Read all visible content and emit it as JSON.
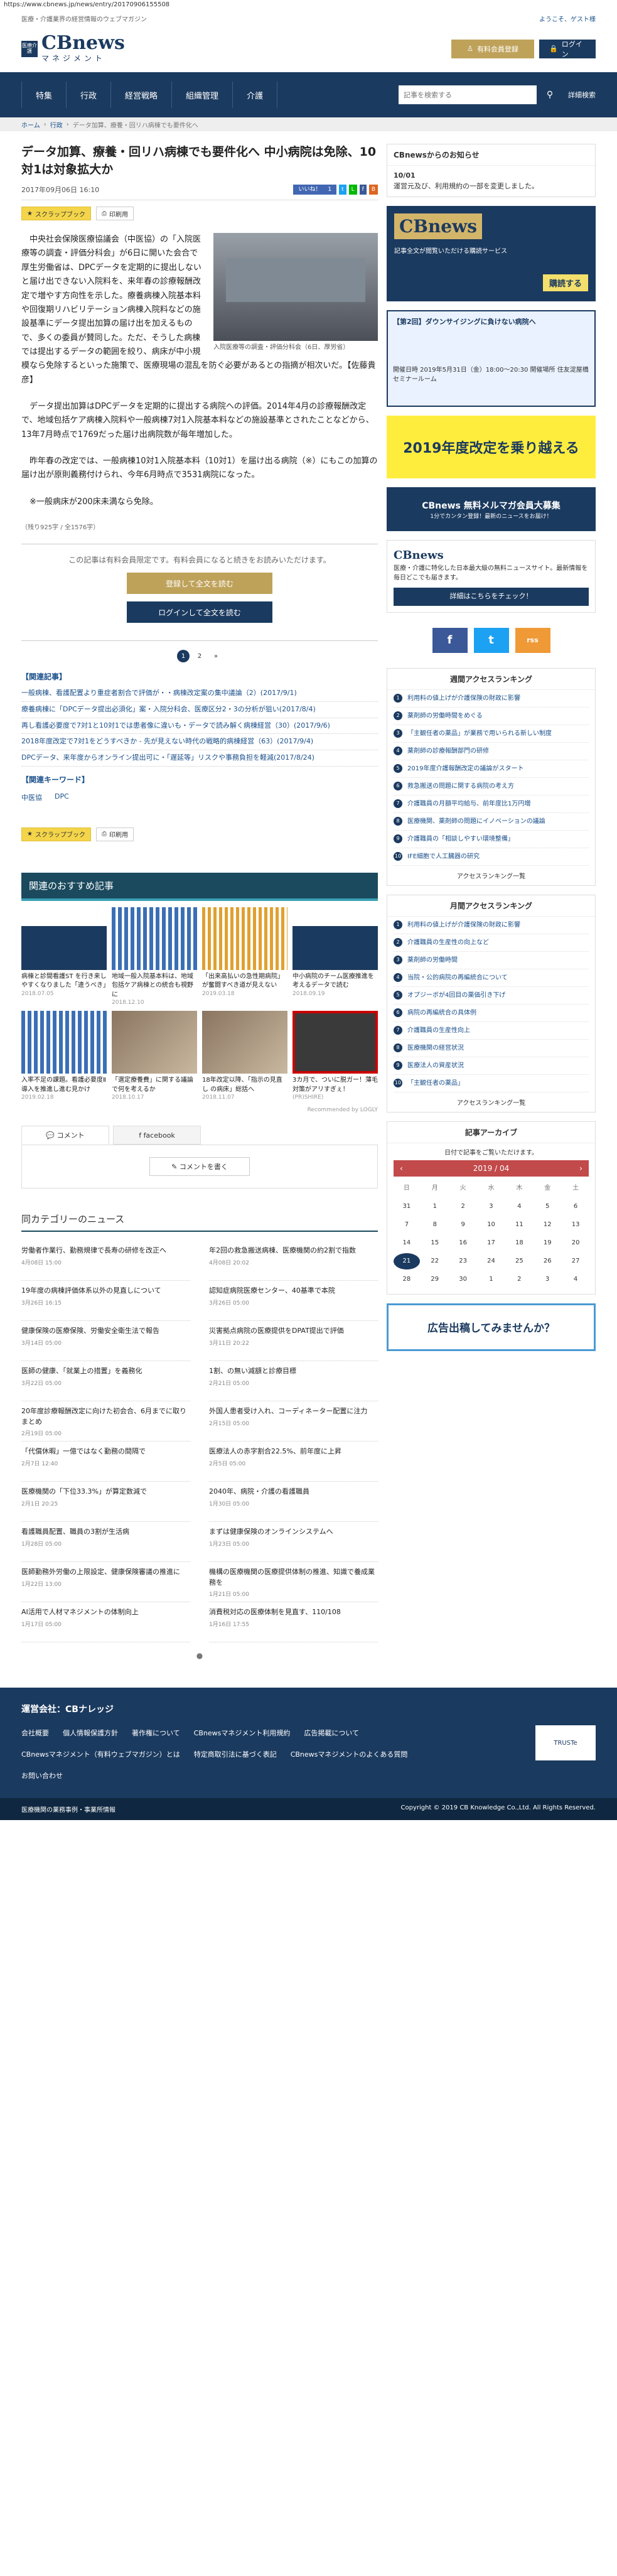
{
  "url": "https://www.cbnews.jp/news/entry/20170906155508",
  "top": {
    "tagline": "医療・介護業界の経営情報のウェブマガジン",
    "welcome": "ようこそ、ゲスト様"
  },
  "header": {
    "badge": "医療介護",
    "logo": "CBnews",
    "logo_sub": "マネジメント",
    "btn_register": "有料会員登録",
    "btn_login": "ログイン"
  },
  "nav": {
    "items": [
      "特集",
      "行政",
      "経営戦略",
      "組織管理",
      "介護"
    ],
    "search_placeholder": "記事を検索する",
    "adv_search": "詳細検索"
  },
  "crumb": [
    "ホーム",
    "行政",
    "データ加算、療養・回リハ病棟でも要件化へ"
  ],
  "article": {
    "title": "データ加算、療養・回リハ病棟でも要件化へ 中小病院は免除、10対1は対象拡大か",
    "date": "2017年09月06日 16:10",
    "like": "いいね！",
    "like_count": "1",
    "scrap": "スクラップブック",
    "print": "印刷用",
    "paragraphs": [
      "中央社会保険医療協議会（中医協）の「入院医療等の調査・評価分科会」が6日に開いた会合で厚生労働省は、DPCデータを定期的に提出しないと届け出できない入院料を、来年春の診療報酬改定で増やす方向性を示した。療養病棟入院基本料や回復期リハビリテーション病棟入院料などの施設基準にデータ提出加算の届け出を加えるもので、多くの委員が賛同した。ただ、そうした病棟では提出するデータの範囲を絞り、病床が中小規模なら免除するといった施策で、医療現場の混乱を防ぐ必要があるとの指摘が相次いだ。【佐藤貴彦】",
      "データ提出加算はDPCデータを定期的に提出する病院への評価。2014年4月の診療報酬改定で、地域包括ケア病棟入院料や一般病棟7対1入院基本料などの施設基準とされたことなどから、13年7月時点で1769だった届け出病院数が毎年増加した。",
      "昨年春の改定では、一般病棟10対1入院基本料（10対1）を届け出る病院（※）にもこの加算の届け出が原則義務付けられ、今年6月時点で3531病院になった。",
      "※一般病床が200床未満なら免除。"
    ],
    "photo_caption": "入院医療等の調査・評価分科会（6日、厚労省）",
    "char_count": "（残り925字 / 全1576字）",
    "paywall_msg": "この記事は有料会員限定です。有料会員になると続きをお読みいただけます。",
    "paywall_register": "登録して全文を読む",
    "paywall_login": "ログインして全文を読む",
    "pages": [
      "1",
      "2",
      "»"
    ],
    "related_title": "【関連記事】",
    "related": [
      "一般病棟、看護配置より重症者割合で評価が・・病棟改定案の集中議論（2）(2017/9/1)",
      "療養病棟に「DPCデータ提出必須化」案・入院分科会、医療区分2・3の分析が狙い(2017/8/4)",
      "再し看護必要度で7対1と10対1では患者像に違いも・データで読み解く病棟経営（30）(2017/9/6)",
      "2018年度改定で7対1をどうすべきか - 先が見えない時代の戦略的病棟経営（63）(2017/9/4)",
      "DPCデータ、来年度からオンライン提出可に・「遅延等」リスクや事務負担を軽減(2017/8/24)"
    ],
    "keyword_title": "【関連キーワード】",
    "keywords": [
      "中医協",
      "DPC"
    ]
  },
  "reco": {
    "title": "関連のおすすめ記事",
    "items": [
      {
        "t": "病棟と診間看護ST を行き来しやすくなりました「違うべき」",
        "d": "2018.07.05"
      },
      {
        "t": "地域一般入院基本料は、地域包括ケア病棟との統合も視野に",
        "d": "2018.12.10"
      },
      {
        "t": "「出来高払いの急性期病院」が奮闘すべき道が見えない",
        "d": "2019.03.18"
      },
      {
        "t": "中小病院のチーム医療推進を考えるデータで読む",
        "d": "2018.09.19"
      },
      {
        "t": "入率不足の課題。看護必要度Ⅱ導入を推進し進む見かけ",
        "d": "2019.02.18"
      },
      {
        "t": "「選定療養費」に関する議論で何を考えるか",
        "d": "2018.10.17"
      },
      {
        "t": "18年改定以降、「指示の見直し の病床」総括へ",
        "d": "2018.11.07"
      },
      {
        "t": "3カ月で、ついに脱ガー！薄毛対策がアリすぎぇ！",
        "d": "(PR)SHIRE)"
      }
    ],
    "logly": "Recommended by LOGLY"
  },
  "comments": {
    "tab1": "コメント",
    "tab2": "facebook",
    "write": "コメントを書く"
  },
  "category": {
    "title": "同カテゴリーのニュース",
    "items": [
      {
        "t": "労働者作業行、勤務規律で長寿の研修を改正へ",
        "d": "4月08日 15:00"
      },
      {
        "t": "年2回の救急搬送病棟、医療機関の約2割で指数",
        "d": "4月08日 20:02"
      },
      {
        "t": "19年度の病棟評価体系以外の見直しについて",
        "d": "3月26日 16:15"
      },
      {
        "t": "認知症病院医療センター、40基準で本院",
        "d": "3月26日 05:00"
      },
      {
        "t": "健康保険の医療保険、労働安全衛生法で報告",
        "d": "3月14日 05:00"
      },
      {
        "t": "災害拠点病院の医療提供をDPAT提出で評価",
        "d": "3月11日 20:22"
      },
      {
        "t": "医師の健康、「就業上の措置」を義務化",
        "d": "3月22日 05:00"
      },
      {
        "t": "1割、の無い減額と診療目標",
        "d": "2月21日 05:00"
      },
      {
        "t": "20年度診療報酬改定に向けた初会合、6月までに取りまとめ",
        "d": "2月19日 05:00"
      },
      {
        "t": "外国人患者受け入れ、コーディネーター配置に注力",
        "d": "2月15日 05:00"
      },
      {
        "t": "「代償休暇」一億ではなく勤務の間隔で",
        "d": "2月7日 12:40"
      },
      {
        "t": "医療法人の赤字割合22.5%、前年度に上昇",
        "d": "2月5日 05:00"
      },
      {
        "t": "医療機関の「下位33.3%」が算定数減で",
        "d": "2月1日 20:25"
      },
      {
        "t": "2040年、病院・介護の看護職員",
        "d": "1月30日 05:00"
      },
      {
        "t": "看護職員配置、職員の3割が生活病",
        "d": "1月28日 05:00"
      },
      {
        "t": "まずは健康保険のオンラインシステムへ",
        "d": "1月23日 05:00"
      },
      {
        "t": "医師勤務外労働の上限設定、健康保険審議の推進に",
        "d": "1月22日 13:00"
      },
      {
        "t": "機構の医療機関の医療提供体制の推進、知識で養成業務を",
        "d": "1月21日 05:00"
      },
      {
        "t": "AI活用で人材マネジメントの体制向上",
        "d": "1月17日 05:00"
      },
      {
        "t": "消費税対応の医療体制を見直す、110/108",
        "d": "1月16日 17:55"
      }
    ]
  },
  "side": {
    "notice_title": "CBnewsからのお知らせ",
    "notice_date": "10/01",
    "notice_text": "運営元及び、利用規約の一部を変更しました。",
    "ad_cb_sub": "記事全文が閲覧いただける購読サービス",
    "ad_cb_cta": "購読する",
    "ad_seminar_title": "【第2回】ダウンサイジングに負けない病院へ",
    "ad_seminar_text": "開催日時 2019年5月31日（金）18:00〜20:30 開催場所 住友淀屋橋セミナールーム",
    "ad_yellow": "2019年度改定を乗り越える",
    "ad_mail": "CBnews 無料メルマガ会員大募集",
    "ad_mail_sub": "1分でカンタン登録！最新のニュースをお届け！",
    "ad_cbnews_text": "医療・介護に特化した日本最大級の無料ニュースサイト。最新情報を毎日どこでも届きます。",
    "ad_cbnews_btn": "詳細はこちらをチェック！",
    "social": [
      "f",
      "t",
      "rss"
    ],
    "weekly_title": "週間アクセスランキング",
    "weekly": [
      "利用料の値上げが介護保険の財政に影響",
      "薬剤師の労働時間をめぐる",
      "「主観任者の薬品」が業務で用いられる新しい制度",
      "薬剤師の診療報酬部門の研修",
      "2019年度介護報酬改定の議論がスタート",
      "救急搬送の問題に関する病院の考え方",
      "介護職員の月額平均給与、前年度比1万円増",
      "医療機関、薬剤師の問題にイノベーションの議論",
      "介護職員の「相談しやすい環境整備」",
      "IFE細胞で人工臓器の研究"
    ],
    "weekly_more": "アクセスランキング一覧",
    "monthly_title": "月間アクセスランキング",
    "monthly": [
      "利用料の値上げが介護保険の財政に影響",
      "介護職員の生産性の向上など",
      "薬剤師の労働時間",
      "当院・公的病院の再編統合について",
      "オプジーボが4回目の薬価引き下げ",
      "病院の再編統合の具体例",
      "介護職員の生産性向上",
      "医療機関の経営状況",
      "医療法人の資産状況",
      "「主観任者の薬品」"
    ],
    "monthly_more": "アクセスランキング一覧",
    "archive_title": "記事アーカイブ",
    "archive_cap": "日付で記事をご覧いただけます。",
    "cal_month": "2019 / 04",
    "cal_head": [
      "日",
      "月",
      "火",
      "水",
      "木",
      "金",
      "土"
    ],
    "cal_days": [
      "31",
      "1",
      "2",
      "3",
      "4",
      "5",
      "6",
      "7",
      "8",
      "9",
      "10",
      "11",
      "12",
      "13",
      "14",
      "15",
      "16",
      "17",
      "18",
      "19",
      "20",
      "21",
      "22",
      "23",
      "24",
      "25",
      "26",
      "27",
      "28",
      "29",
      "30",
      "1",
      "2",
      "3",
      "4"
    ],
    "ad_kk": "広告出稿してみませんか？"
  },
  "footer": {
    "company": "運営会社：CBナレッジ",
    "links": [
      "会社概要",
      "個人情報保護方針",
      "著作権について",
      "CBnewsマネジメント利用規約",
      "広告掲載について",
      "CBnewsマネジメント（有料ウェブマガジン）とは",
      "特定商取引法に基づく表記",
      "CBnewsマネジメントのよくある質問",
      "お問い合わせ"
    ],
    "copyright": "Copyright © 2019 CB Knowledge Co.,Ltd. All Rights Reserved.",
    "note": "医療機関の業務事例・事業所情報"
  },
  "colors": {
    "navy": "#1b3a5f",
    "gold": "#bfa25a",
    "teal": "#1b4a5e"
  }
}
